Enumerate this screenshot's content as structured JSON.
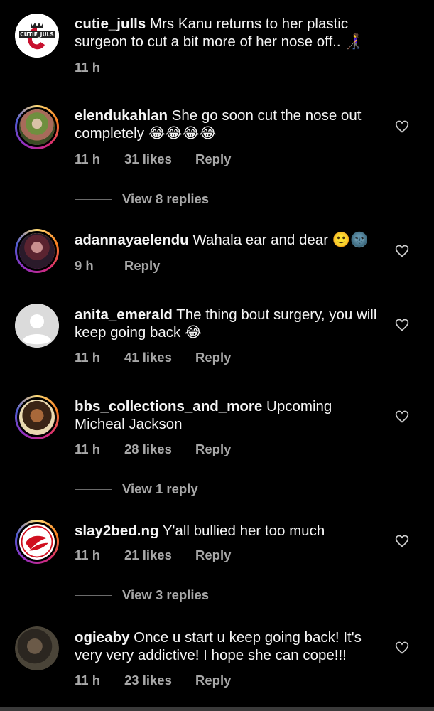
{
  "caption": {
    "username": "cutie_julls",
    "avatar_label": "CUTIE_JULS",
    "text": "Mrs Kanu returns to her plastic surgeon to cut a bit more of her nose off.. 👩‍🦯",
    "time": "11 h"
  },
  "comments": [
    {
      "username": "elendukahlan",
      "text": "She go soon cut the nose out completely",
      "emoji": "😂😂😂😂",
      "time": "11 h",
      "likes": "31 likes",
      "reply": "Reply",
      "view_replies": "View 8 replies"
    },
    {
      "username": "adannayaelendu",
      "text": "Wahala ear and dear",
      "emoji": "🙂🌚",
      "time": "9 h",
      "likes": "",
      "reply": "Reply"
    },
    {
      "username": "anita_emerald",
      "text": "The thing bout surgery, you will keep going back",
      "emoji": "😂",
      "time": "11 h",
      "likes": "41 likes",
      "reply": "Reply"
    },
    {
      "username": "bbs_collections_and_more",
      "text": "Upcoming Micheal Jackson",
      "time": "11 h",
      "likes": "28 likes",
      "reply": "Reply",
      "view_replies": "View 1 reply"
    },
    {
      "username": "slay2bed.ng",
      "text": "Y'all bullied her too much",
      "time": "11 h",
      "likes": "21 likes",
      "reply": "Reply",
      "view_replies": "View 3 replies"
    },
    {
      "username": "ogieaby",
      "text": "Once u start u keep going back! It's very very addictive! I hope she can cope!!!",
      "time": "11 h",
      "likes": "23 likes",
      "reply": "Reply"
    }
  ],
  "icons": {
    "heart": "heart-outline-icon"
  },
  "colors": {
    "background": "#000000",
    "text": "#f5f5f5",
    "meta": "#a8a8a8"
  }
}
